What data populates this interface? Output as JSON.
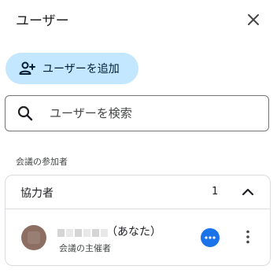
{
  "header": {
    "title": "ユーザー",
    "close_icon": "close-icon"
  },
  "add_user": {
    "label": "ユーザーを追加",
    "icon": "person-add-icon"
  },
  "search": {
    "placeholder": "ユーザーを検索",
    "value": "",
    "icon": "search-icon"
  },
  "section_label": "会議の参加者",
  "panel": {
    "name": "協力者",
    "count": "1",
    "chevron_icon": "chevron-up-icon",
    "participants": [
      {
        "name_suffix": "（あなた）",
        "role": "会議の主催者",
        "badge_icon": "more-horiz-icon",
        "menu_icon": "more-vert-icon"
      }
    ]
  },
  "colors": {
    "accent": "#1a73e8",
    "add_button_bg": "#c2e7ff",
    "avatar": "#8d6e63"
  }
}
